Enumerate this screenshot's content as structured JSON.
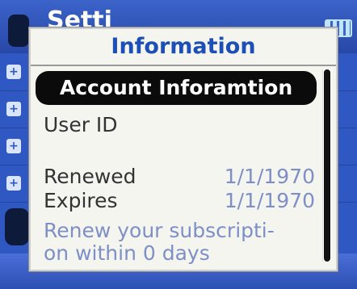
{
  "background_app": {
    "title": "Setti"
  },
  "dialog": {
    "title": "Information",
    "section_header": "Account Inforamtion",
    "rows": [
      {
        "label": "User ID",
        "value": ""
      },
      {
        "label": "Renewed",
        "value": "1/1/1970"
      },
      {
        "label": "Expires",
        "value": "1/1/1970"
      }
    ],
    "notice": "Renew your subscripti-\non within 0 days"
  },
  "colors": {
    "accent": "#1d4fb8",
    "value_text": "#7d8fc6",
    "header_bg": "#0b0b0b",
    "background_blue": "#2f58c2"
  }
}
